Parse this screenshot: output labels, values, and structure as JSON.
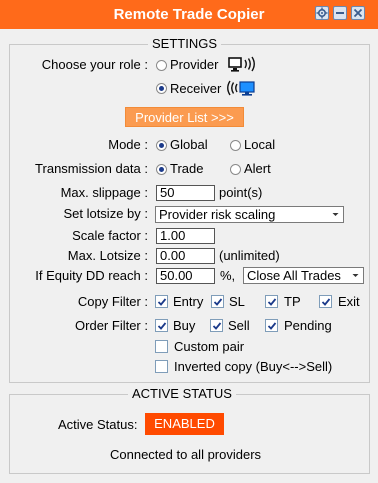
{
  "window": {
    "title": "Remote Trade Copier",
    "buttons": [
      "gear-icon",
      "minimize-icon",
      "close-icon"
    ],
    "accent": "#ff6a1a"
  },
  "settings": {
    "legend": "SETTINGS",
    "role": {
      "label": "Choose your role :",
      "provider": "Provider",
      "receiver": "Receiver",
      "selected": "Receiver"
    },
    "provider_list_button": "Provider List >>>",
    "mode": {
      "label": "Mode :",
      "global": "Global",
      "local": "Local",
      "selected": "Global"
    },
    "transmission": {
      "label": "Transmission data :",
      "trade": "Trade",
      "alert": "Alert",
      "selected": "Trade"
    },
    "max_slippage": {
      "label": "Max. slippage :",
      "value": "50",
      "unit": "point(s)"
    },
    "lotsize": {
      "label": "Set lotsize by :",
      "value": "Provider risk scaling"
    },
    "scale_factor": {
      "label": "Scale factor :",
      "value": "1.00"
    },
    "max_lotsize": {
      "label": "Max. Lotsize :",
      "value": "0.00",
      "note": "(unlimited)"
    },
    "equity_dd": {
      "label": "If Equity DD reach :",
      "value": "50.00",
      "unit": "%,",
      "action": "Close All Trades"
    },
    "copy_filter": {
      "label": "Copy Filter :",
      "items": [
        {
          "label": "Entry",
          "checked": true
        },
        {
          "label": "SL",
          "checked": true
        },
        {
          "label": "TP",
          "checked": true
        },
        {
          "label": "Exit",
          "checked": true
        }
      ]
    },
    "order_filter": {
      "label": "Order Filter :",
      "items": [
        {
          "label": "Buy",
          "checked": true
        },
        {
          "label": "Sell",
          "checked": true
        },
        {
          "label": "Pending",
          "checked": true
        }
      ]
    },
    "custom_pair": {
      "label": "Custom pair",
      "checked": false
    },
    "inverted_copy": {
      "label": "Inverted copy (Buy<-->Sell)",
      "checked": false
    }
  },
  "status": {
    "legend": "ACTIVE STATUS",
    "label": "Active Status:",
    "value": "ENABLED",
    "message": "Connected to all providers",
    "badge_color": "#ff4a00"
  }
}
